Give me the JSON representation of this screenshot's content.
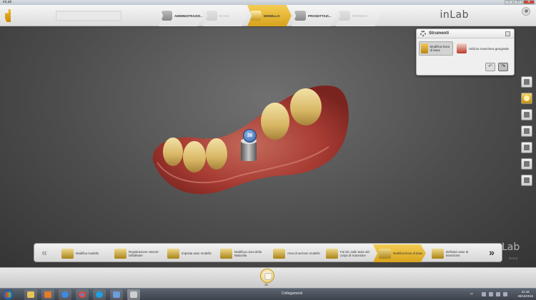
{
  "window": {
    "title": "inLab",
    "minimize": "–",
    "maximize": "□",
    "close": "✕"
  },
  "header": {
    "brand": "inLab",
    "phases": [
      {
        "label": "AMMINISTRAZIO...",
        "state": "normal"
      },
      {
        "label": "SCAN",
        "state": "dim"
      },
      {
        "label": "MODELLO",
        "state": "active"
      },
      {
        "label": "PROGETTAZI...",
        "state": "normal"
      },
      {
        "label": "PRODUCI",
        "state": "dim"
      }
    ]
  },
  "tools_panel": {
    "title": "Strumenti",
    "tools": [
      {
        "label": "Modifica linea di base",
        "selected": true,
        "icon": "base-line-icon"
      },
      {
        "label": "Utilizza maschera gengivale",
        "selected": false,
        "icon": "gingiva-mask-icon"
      }
    ],
    "undo": "↶",
    "redo": "↷"
  },
  "model": {
    "tooth_number": "36"
  },
  "workflow": {
    "prev": "«",
    "next": "»",
    "steps": [
      {
        "label": "Modifica modello",
        "active": false
      },
      {
        "label": "Registrazione mascel- lo/bolleare",
        "active": false
      },
      {
        "label": "Imposta asse modello",
        "active": false
      },
      {
        "label": "Modifica Linea della Mascella",
        "active": false
      },
      {
        "label": "Area di sezione modello",
        "active": false
      },
      {
        "label": "Fai clic sulle teste del corpo di scansione",
        "active": false
      },
      {
        "label": "Modifica linea di base",
        "active": true
      },
      {
        "label": "Definisci asse di inserzione",
        "active": false
      }
    ],
    "brand": "Lab",
    "brand_sub": "sirona"
  },
  "status": {
    "tooth_number": "36"
  },
  "taskbar": {
    "center_text": "Collegamenti",
    "language": "IT",
    "time": "21:18",
    "date": "28/10/2015"
  },
  "colors": {
    "accent": "#d8a21c",
    "canvas": "#4d4d4d",
    "tooth_label": "#2f5fa6"
  }
}
